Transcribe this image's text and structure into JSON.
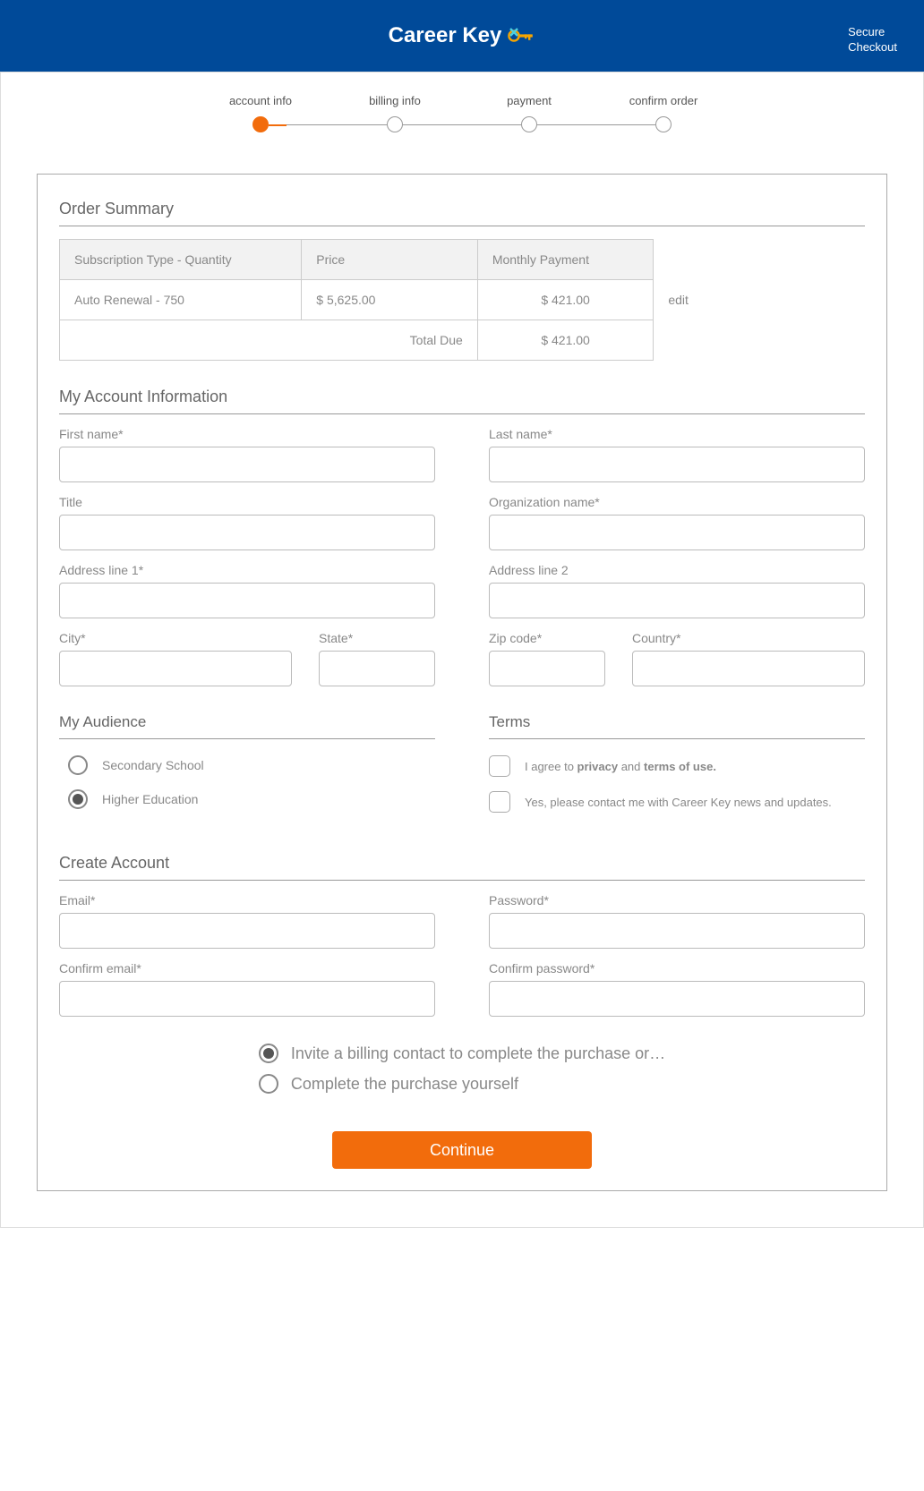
{
  "header": {
    "logo_text": "Career Key",
    "secure_checkout": "Secure Checkout"
  },
  "progress": {
    "steps": [
      "account info",
      "billing info",
      "payment",
      "confirm order"
    ],
    "active_index": 0
  },
  "order_summary": {
    "title": "Order Summary",
    "headers": [
      "Subscription Type - Quantity",
      "Price",
      "Monthly Payment"
    ],
    "row": {
      "subscription": "Auto Renewal - 750",
      "price": "$ 5,625.00",
      "monthly": "$   421.00"
    },
    "total_label": "Total Due",
    "total_value": "$   421.00",
    "edit": "edit"
  },
  "account": {
    "title": "My Account Information",
    "fields": {
      "first_name": "First name*",
      "last_name": "Last name*",
      "title": "Title",
      "org_name": "Organization name*",
      "address1": "Address line 1*",
      "address2": "Address line 2",
      "city": "City*",
      "state": "State*",
      "zip": "Zip code*",
      "country": "Country*"
    }
  },
  "audience": {
    "title": "My Audience",
    "secondary": "Secondary School",
    "higher_ed": "Higher Education",
    "selected": "higher_ed"
  },
  "terms": {
    "title": "Terms",
    "agree_pre": "I agree to ",
    "privacy": "privacy",
    "and": " and ",
    "terms": "terms of use.",
    "contact": "Yes, please contact me with Career Key news and updates."
  },
  "create": {
    "title": "Create Account",
    "fields": {
      "email": "Email*",
      "password": "Password*",
      "confirm_email": "Confirm email*",
      "confirm_password": "Confirm password*"
    }
  },
  "billing_option": {
    "invite": "Invite a billing contact to complete the purchase or…",
    "yourself": "Complete the purchase yourself",
    "selected": "invite"
  },
  "continue_label": "Continue"
}
